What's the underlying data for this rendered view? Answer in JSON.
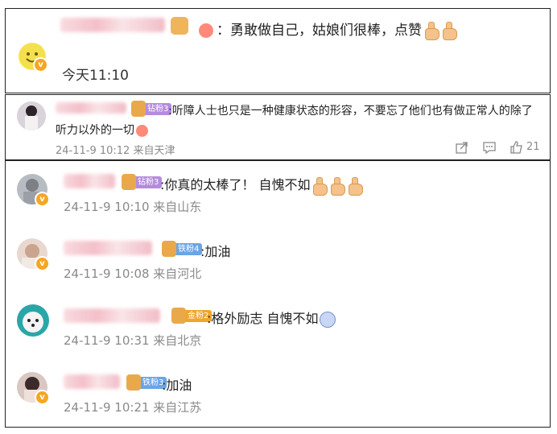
{
  "top_comment": {
    "text": "：勇敢做自己，姑娘们很棒，点赞",
    "time": "今天11:10"
  },
  "reply_main": {
    "badge": "钻粉3",
    "text_line1": ":听障人士也只是一种健康状态的形容，不要忘了他们也有做正常人的除了",
    "text_line2": "听力以外的一切",
    "meta": "24-11-9 10:12 来自天津",
    "like_count": "21",
    "actions": {
      "share": "share-icon",
      "comment": "comment-icon",
      "like": "like-icon"
    }
  },
  "comments": [
    {
      "badge": "钻粉3",
      "badge_color": "#b58be0",
      "text": ":你真的太棒了！ 自愧不如",
      "meta": "24-11-9 10:10 来自山东"
    },
    {
      "badge": "铁粉4",
      "badge_color": "#6aa5e6",
      "text": ":加油",
      "meta": "24-11-9 10:08 来自河北"
    },
    {
      "badge": "金粉2",
      "badge_color": "#f0a52c",
      "text": ":格外励志 自愧不如",
      "meta": "24-11-9 10:31 来自北京"
    },
    {
      "badge": "铁粉3",
      "badge_color": "#6aa5e6",
      "text": ":加油",
      "meta": "24-11-9 10:21 来自江苏"
    }
  ]
}
